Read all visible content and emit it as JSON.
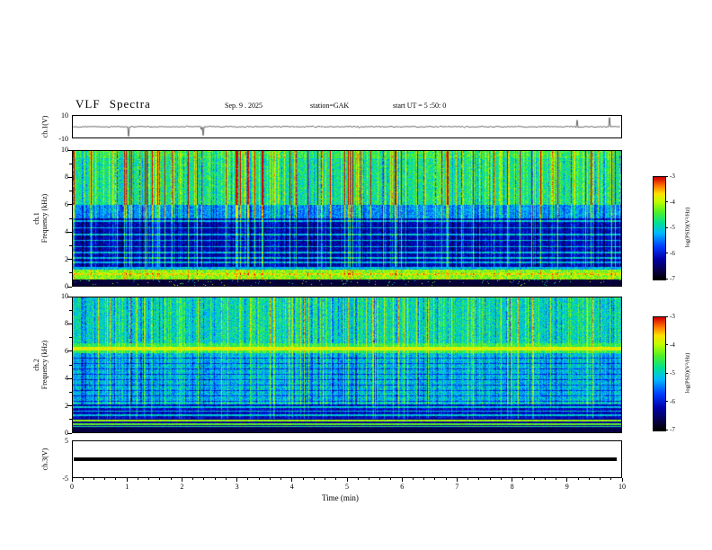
{
  "title": "VLF Spectra",
  "header": {
    "date": "Sep. 9 . 2025",
    "station": "station=GAK",
    "start_ut": "start UT =  5 :50: 0"
  },
  "xaxis": {
    "label": "Time (min)",
    "ticks": [
      "0",
      "1",
      "2",
      "3",
      "4",
      "5",
      "6",
      "7",
      "8",
      "9",
      "10"
    ],
    "range": [
      0,
      10
    ]
  },
  "colorbar": {
    "label": "log(PSD)(V²/Hz)",
    "ticks": [
      "-3",
      "-4",
      "-5",
      "-6",
      "-7"
    ],
    "top_value": -3,
    "bottom_value": -7
  },
  "panels": {
    "wave": {
      "label": "ch.1(V)",
      "ymax": "10",
      "ymin": "-10"
    },
    "spec1": {
      "label_ch": "ch.1",
      "label_axis": "Frequency (kHz)",
      "yticks": [
        "10",
        "8",
        "6",
        "4",
        "2",
        "0"
      ]
    },
    "spec2": {
      "label_ch": "ch.2",
      "label_axis": "Frequency (kHz)",
      "yticks": [
        "10",
        "8",
        "6",
        "4",
        "2",
        "0"
      ]
    },
    "ch3": {
      "label": "ch.3(V)",
      "ymax": "5",
      "ymin": "-5"
    }
  },
  "colors": {
    "background": "#ffffff",
    "hot": "#d20000",
    "cold": "#000000",
    "deep_blue": "#0000aa"
  },
  "chart_data": [
    {
      "type": "line",
      "title": "ch.1 voltage time series",
      "xlabel": "Time (min)",
      "ylabel": "ch.1(V)",
      "xlim": [
        0,
        10
      ],
      "ylim": [
        -10,
        10
      ],
      "yticks": [
        10,
        -10
      ],
      "description": "Noisy trace centered near 0 V with sporadic impulsive spikes reaching toward ±10 V throughout the 10-minute record."
    },
    {
      "type": "heatmap",
      "title": "ch.1 VLF spectrogram",
      "xlabel": "Time (min)",
      "ylabel": "Frequency (kHz)",
      "xlim": [
        0,
        10
      ],
      "ylim": [
        0,
        10
      ],
      "yticks": [
        0,
        2,
        4,
        6,
        8,
        10
      ],
      "colorbar_label": "log(PSD)(V²/Hz)",
      "colorbar_range": [
        -7,
        -3
      ],
      "features": [
        "broadband green/yellow power above ~6 kHz with dense red vertical sferic streaks",
        "low-power blue/dark band between ~1.5 and 6 kHz crossed by vertical streaks and faint horizontal carrier lines",
        "intense yellow-orange band between ~0.4 and 1.2 kHz",
        "near-black lowest-frequency band below ~0.4 kHz"
      ]
    },
    {
      "type": "heatmap",
      "title": "ch.2 VLF spectrogram",
      "xlabel": "Time (min)",
      "ylabel": "Frequency (kHz)",
      "xlim": [
        0,
        10
      ],
      "ylim": [
        0,
        10
      ],
      "yticks": [
        0,
        2,
        4,
        6,
        8,
        10
      ],
      "colorbar_label": "log(PSD)(V²/Hz)",
      "colorbar_range": [
        -7,
        -3
      ],
      "features": [
        "green/cyan broadband background from ~2 to 10 kHz with vertical sferic streaks",
        "persistent yellow-orange horizontal line near 6.2 kHz",
        "layered horizontal stripes and blue low-power bands below ~2 kHz",
        "dark band at the lowest frequencies"
      ]
    },
    {
      "type": "line",
      "title": "ch.3 voltage time series",
      "xlabel": "Time (min)",
      "ylabel": "ch.3(V)",
      "xlim": [
        0,
        10
      ],
      "ylim": [
        -5,
        5
      ],
      "yticks": [
        5,
        -5
      ],
      "description": "Flat constant trace at 0 V (thick black line) across the entire interval."
    }
  ]
}
